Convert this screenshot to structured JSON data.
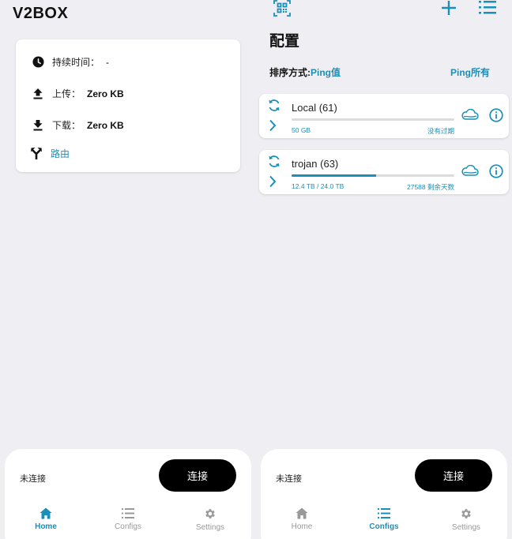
{
  "home": {
    "app_title": "V2BOX",
    "duration_label": "持续时间：",
    "duration_value": "-",
    "upload_label": "上传：",
    "upload_value": "Zero KB",
    "download_label": "下载：",
    "download_value": "Zero KB",
    "route_label": "路由"
  },
  "configs": {
    "title": "配置",
    "sort_label": "排序方式:",
    "sort_value": "Ping值",
    "ping_all_label": "Ping所有",
    "items": [
      {
        "name": "Local (61)",
        "size": "50 GB",
        "expire": "没有过期",
        "usage_fraction": 0.0
      },
      {
        "name": "trojan (63)",
        "size": "12.4 TB / 24.0 TB",
        "expire": "27588 剩余天数",
        "usage_fraction": 0.52
      }
    ]
  },
  "bottom": {
    "status": "未连接",
    "connect_label": "连接"
  },
  "nav": {
    "home": "Home",
    "configs": "Configs",
    "settings": "Settings"
  },
  "colors": {
    "accent": "#1a8fb8",
    "background": "#efeff3",
    "card": "#ffffff",
    "button": "#000000"
  }
}
